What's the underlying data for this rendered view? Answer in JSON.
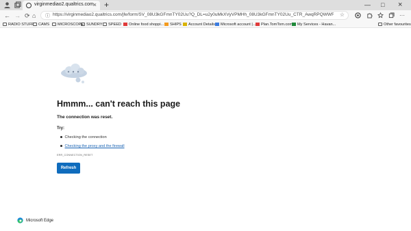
{
  "tab": {
    "title": "virginmediao2.qualtrics.com",
    "close": "×"
  },
  "newtab": "+",
  "window": {
    "min": "—",
    "max": "□",
    "close": "×"
  },
  "nav": {
    "back": "←",
    "forward": "→",
    "refresh": "⟳",
    "home": "⌂"
  },
  "address": {
    "url": "https://virginmediao2.qualtrics.com/jfe/form/SV_08U3kGFmnTY02Uu?Q_DL=u2y0uMkXVyVPMHh_08U3kGFmnTY02Uu_CTR_AwqRPQWWRVg7xD&Q_CHL=email&Q_Popul..."
  },
  "bookmarks": [
    {
      "label": "RADIO STUFF",
      "kind": "folder"
    },
    {
      "label": "CAMS",
      "kind": "folder"
    },
    {
      "label": "MICROSCOPE",
      "kind": "folder"
    },
    {
      "label": "SUNDRY",
      "kind": "folder"
    },
    {
      "label": "SPEED",
      "kind": "folder"
    },
    {
      "label": "Online food shoppi...",
      "kind": "site",
      "color": "#e03a3a"
    },
    {
      "label": "SHIPS",
      "kind": "site",
      "color": "#f39a1e"
    },
    {
      "label": "Account Details",
      "kind": "site",
      "color": "#d9b300"
    },
    {
      "label": "Microsoft account |...",
      "kind": "site",
      "color": "#3a7be0"
    },
    {
      "label": "Plan.TomTom.com",
      "kind": "site",
      "color": "#e03a3a"
    },
    {
      "label": "My Services - Havan...",
      "kind": "site",
      "color": "#1f8a3a"
    }
  ],
  "other_favourites": "Other favourites",
  "error": {
    "heading": "Hmmm... can't reach this page",
    "reason": "The connection was reset.",
    "try_label": "Try:",
    "suggestions": [
      "Checking the connection",
      "Checking the proxy and the firewall"
    ],
    "code": "ERR_CONNECTION_RESET",
    "refresh": "Refresh"
  },
  "brand": "Microsoft Edge",
  "colors": {
    "accent": "#0f6cbd",
    "link": "#1a64b4"
  }
}
